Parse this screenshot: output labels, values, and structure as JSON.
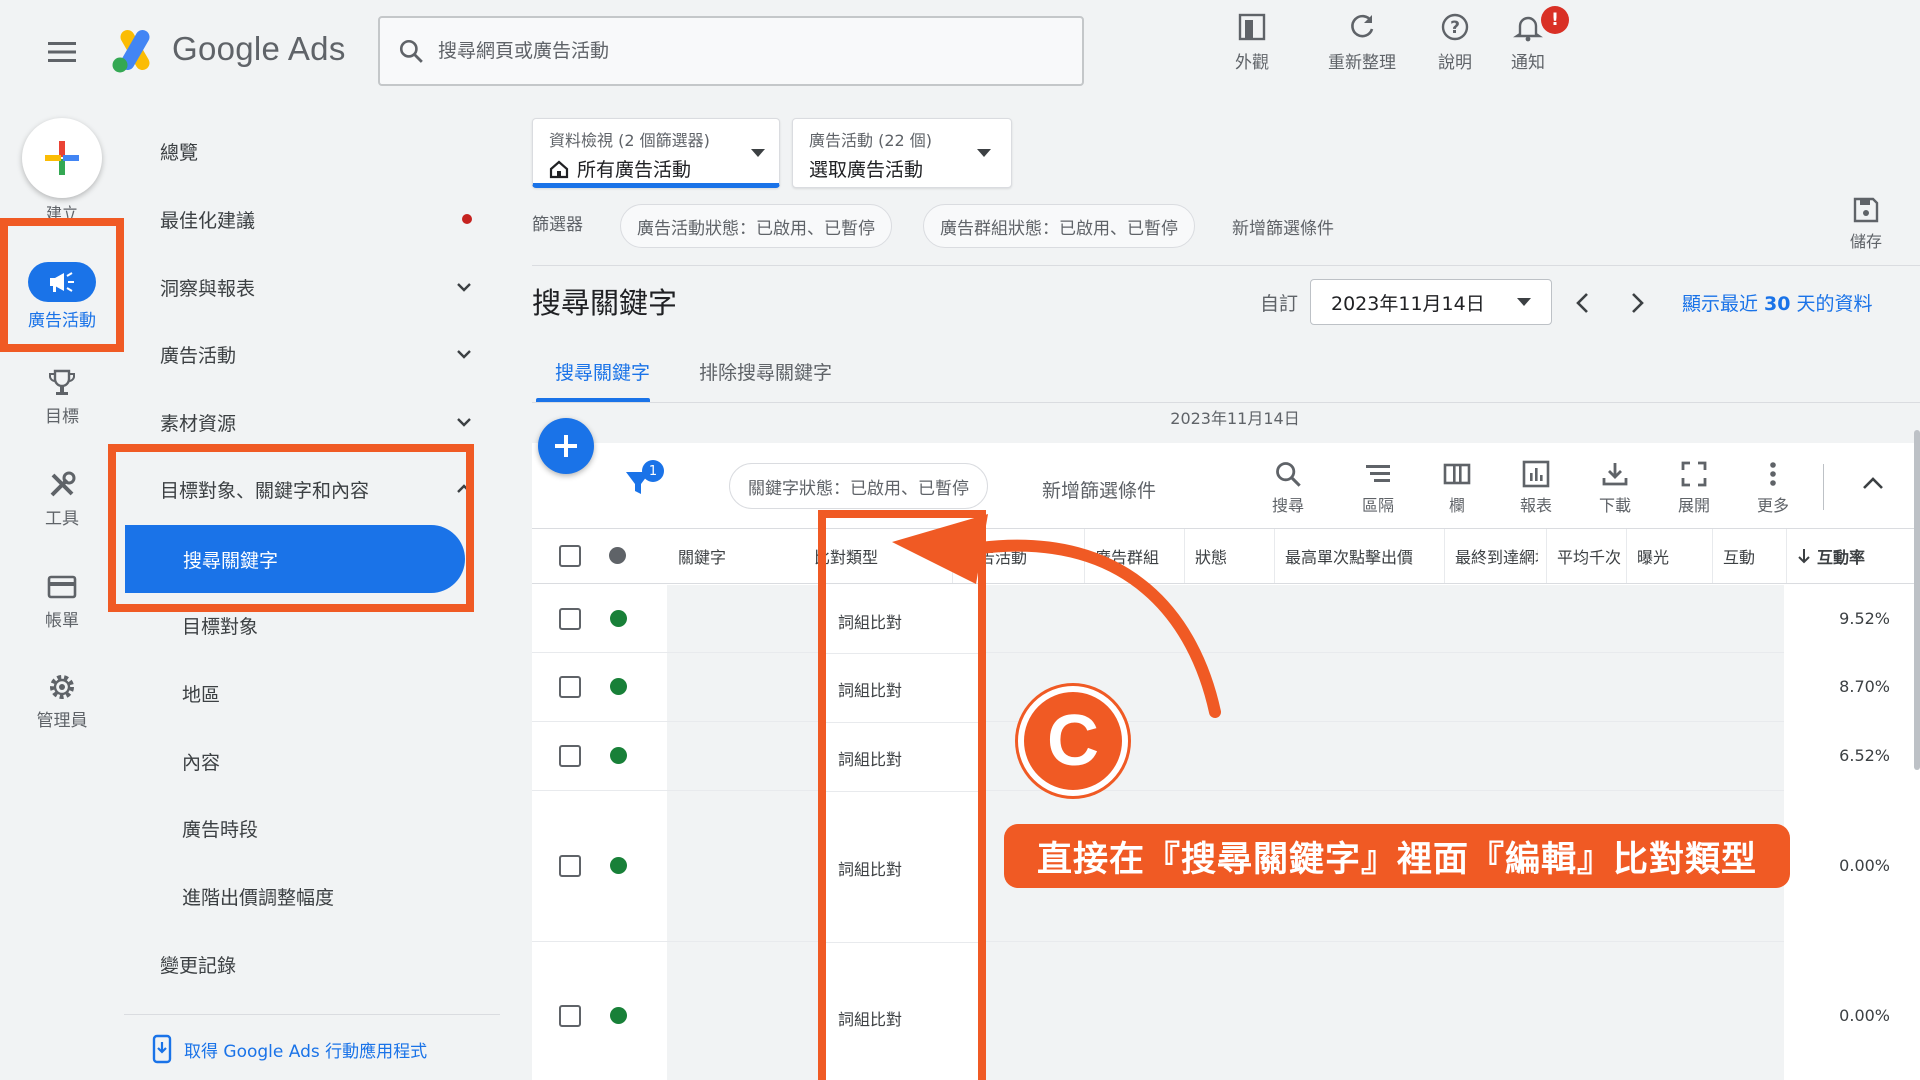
{
  "header": {
    "logo_text": "Google Ads",
    "search_placeholder": "搜尋網頁或廣告活動",
    "actions": {
      "appearance": "外觀",
      "refresh": "重新整理",
      "help": "說明",
      "notifications": "通知"
    },
    "notification_count": "!"
  },
  "rail": {
    "create": "建立",
    "campaigns": "廣告活動",
    "goals": "目標",
    "tools": "工具",
    "billing": "帳單",
    "admin": "管理員"
  },
  "nav": {
    "overview": "總覽",
    "recommendations": "最佳化建議",
    "insights": "洞察與報表",
    "campaigns": "廣告活動",
    "assets": "素材資源",
    "audiences_keywords": "目標對象、關鍵字和內容",
    "search_keywords": "搜尋關鍵字",
    "audiences": "目標對象",
    "locations": "地區",
    "content": "內容",
    "ad_schedule": "廣告時段",
    "bid_adjustments": "進階出價調整幅度",
    "change_history": "變更記錄",
    "app_link": "取得 Google Ads 行動應用程式"
  },
  "selectors": {
    "view": {
      "label": "資料檢視 (2 個篩選器)",
      "value": "所有廣告活動"
    },
    "campaign": {
      "label": "廣告活動 (22 個)",
      "value": "選取廣告活動"
    }
  },
  "filters": {
    "label": "篩選器",
    "chips": [
      "廣告活動狀態：已啟用、已暫停",
      "廣告群組狀態：已啟用、已暫停"
    ],
    "add": "新增篩選條件",
    "save": "儲存"
  },
  "page": {
    "title": "搜尋關鍵字",
    "date_label": "自訂",
    "date_value": "2023年11月14日",
    "show_30_prefix": "顯示最近 ",
    "show_30_num": "30",
    "show_30_suffix": " 天的資料",
    "tabs": [
      "搜尋關鍵字",
      "排除搜尋關鍵字"
    ],
    "date_caption": "2023年11月14日"
  },
  "table_toolbar": {
    "filter_count": "1",
    "keyword_chip": "關鍵字狀態：已啟用、已暫停",
    "add_filter": "新增篩選條件",
    "tools": [
      "搜尋",
      "區隔",
      "欄",
      "報表",
      "下載",
      "展開",
      "更多"
    ]
  },
  "table": {
    "headers": [
      "關鍵字",
      "比對類型",
      "廣告活動",
      "廣告群組",
      "狀態",
      "最高單次點擊出價",
      "最終到達網址",
      "平均千次",
      "曝光",
      "互動",
      "互動率"
    ],
    "rows": [
      {
        "match_type": "詞組比對",
        "rate": "9.52%"
      },
      {
        "match_type": "詞組比對",
        "rate": "8.70%"
      },
      {
        "match_type": "詞組比對",
        "rate": "6.52%"
      },
      {
        "match_type": "詞組比對",
        "rate": "0.00%"
      },
      {
        "match_type": "詞組比對",
        "rate": "0.00%"
      }
    ]
  },
  "annotation": {
    "letter": "C",
    "callout": "直接在『搜尋關鍵字』裡面『編輯』比對類型"
  },
  "colors": {
    "accent": "#1a73e8",
    "highlight": "#f05a24",
    "enabled": "#188038",
    "alert": "#d93025"
  }
}
